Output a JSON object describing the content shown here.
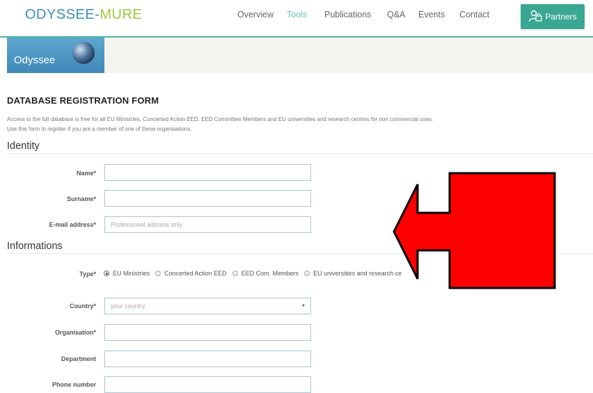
{
  "header": {
    "logo_part1": "ODYSSEE-",
    "logo_part2": "MURE",
    "nav": [
      "Overview",
      "Tools",
      "Publications",
      "Q&A",
      "Events",
      "Contact"
    ],
    "active_nav": "Tools",
    "partners_label": "Partners",
    "accent_color": "#3aa793"
  },
  "banner": {
    "label": "Odyssee"
  },
  "form": {
    "title": "DATABASE REGISTRATION FORM",
    "intro_line1": "Access to the full database is free for all EU Ministries, Concerted Action EED, EED Committee Members and EU universities and research centres for non commercial uses.",
    "intro_line2": "Use this form to register if you are a member of one of these organisations.",
    "identity": {
      "title": "Identity",
      "name_label": "Name*",
      "surname_label": "Surname*",
      "email_label": "E-mail address*",
      "email_placeholder": "Professional address only"
    },
    "informations": {
      "title": "Informations",
      "type_label": "Type*",
      "type_options": [
        "EU Ministries",
        "Concerted Action EED",
        "EED Com. Members",
        "EU universities and research ce"
      ],
      "type_selected": "EU Ministries",
      "country_label": "Country*",
      "country_value": "your country",
      "organisation_label": "Organisation*",
      "department_label": "Department",
      "phone_label": "Phone number"
    }
  },
  "overlay": {
    "arrow_color": "#ff0000",
    "arrow_direction": "left"
  }
}
